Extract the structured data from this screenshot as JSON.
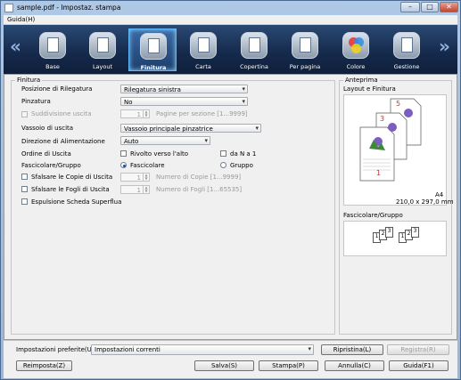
{
  "window": {
    "title": "sample.pdf - Impostaz. stampa"
  },
  "menu": {
    "help": "Guida(H)"
  },
  "tabs": [
    {
      "label": "Base"
    },
    {
      "label": "Layout"
    },
    {
      "label": "Finitura"
    },
    {
      "label": "Carta"
    },
    {
      "label": "Copertina"
    },
    {
      "label": "Per pagina"
    },
    {
      "label": "Colore"
    },
    {
      "label": "Gestione"
    }
  ],
  "finitura": {
    "group_title": "Finitura",
    "posizione_rilegatura": {
      "label": "Posizione di Rilegatura",
      "value": "Rilegatura sinistra"
    },
    "pinzatura": {
      "label": "Pinzatura",
      "value": "No"
    },
    "suddivisione": {
      "label": "Suddivisione uscita",
      "value": "1",
      "suffix": "Pagine per sezione [1...9999]"
    },
    "vassoio": {
      "label": "Vassoio di uscita",
      "value": "Vassoio principale pinzatrice"
    },
    "direzione": {
      "label": "Direzione di Alimentazione",
      "value": "Auto"
    },
    "ordine": {
      "label": "Ordine di Uscita",
      "option1": "Rivolto verso l'alto",
      "option2": "da N a 1"
    },
    "fascicolare": {
      "label": "Fascicolare/Gruppo",
      "option1": "Fascicolare",
      "option2": "Gruppo"
    },
    "sfalsare_copie": {
      "label": "Sfalsare le Copie di Uscita",
      "value": "1",
      "suffix": "Numero di Copie [1...9999]"
    },
    "sfalsare_fogli": {
      "label": "Sfalsare le Fogli di Uscita",
      "value": "1",
      "suffix": "Numero di Fogli [1...65535]"
    },
    "espulsione": {
      "label": "Espulsione Scheda Superflua"
    }
  },
  "anteprima": {
    "group_title": "Anteprima",
    "layout_title": "Layout e Finitura",
    "paper": "A4",
    "paper_size": "210,0 x 297,0 mm",
    "fascicolare_title": "Fascicolare/Gruppo",
    "page_numbers": [
      "5",
      "3",
      "1"
    ],
    "collate_digits": [
      "1",
      "2",
      "3"
    ]
  },
  "preferiti": {
    "label": "Impostazioni preferite(U)",
    "value": "Impostazioni correnti",
    "ripristina": "Ripristina(L)",
    "registra": "Registra(R)"
  },
  "buttons": {
    "reimposta": "Reimposta(Z)",
    "salva": "Salva(S)",
    "stampa": "Stampa(P)",
    "annulla": "Annulla(C)",
    "guida": "Guida(F1)"
  }
}
